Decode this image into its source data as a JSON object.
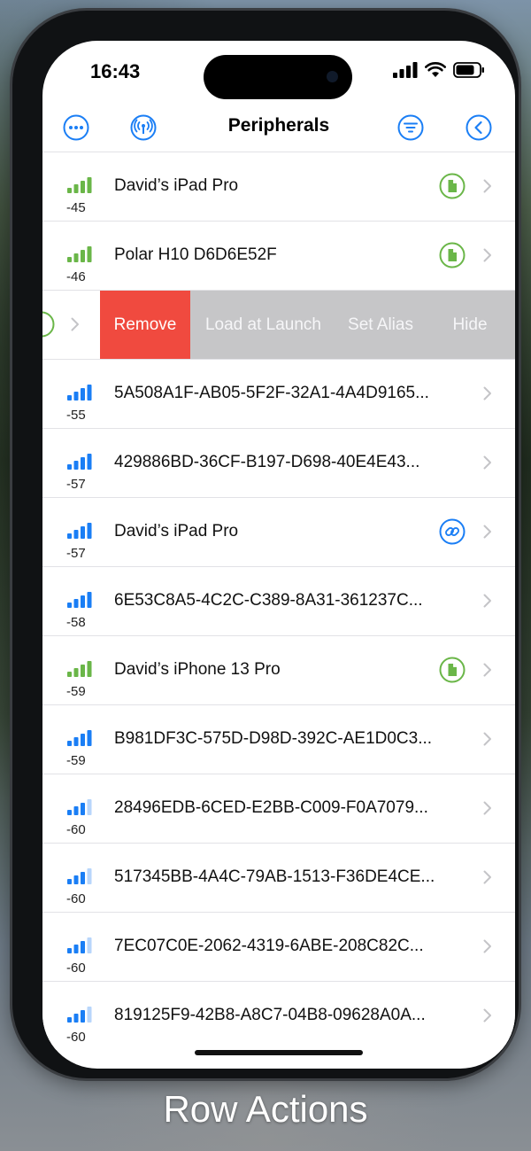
{
  "status_bar": {
    "time": "16:43"
  },
  "nav": {
    "title": "Peripherals"
  },
  "colors": {
    "accent": "#1a7ef5",
    "signal_green": "#6ab648",
    "remove_red": "#f04a3f",
    "action_gray": "#c6c6c8"
  },
  "rows_before": [
    {
      "rssi": "-45",
      "name": "David’s iPad Pro",
      "signal_color": "green",
      "bars": 4,
      "badge": "document-icon"
    },
    {
      "rssi": "-46",
      "name": "Polar H10 D6D6E52F",
      "signal_color": "green",
      "bars": 4,
      "badge": "document-icon"
    }
  ],
  "swipe_actions": [
    "Remove",
    "Load at Launch",
    "Set Alias",
    "Hide"
  ],
  "rows_after": [
    {
      "rssi": "-55",
      "name": "5A508A1F-AB05-5F2F-32A1-4A4D9165...",
      "signal_color": "blue",
      "bars": 4,
      "badge": ""
    },
    {
      "rssi": "-57",
      "name": "429886BD-36CF-B197-D698-40E4E43...",
      "signal_color": "blue",
      "bars": 4,
      "badge": ""
    },
    {
      "rssi": "-57",
      "name": "David’s iPad Pro",
      "signal_color": "blue",
      "bars": 4,
      "badge": "link-icon"
    },
    {
      "rssi": "-58",
      "name": "6E53C8A5-4C2C-C389-8A31-361237C...",
      "signal_color": "blue",
      "bars": 4,
      "badge": ""
    },
    {
      "rssi": "-59",
      "name": "David’s iPhone 13 Pro",
      "signal_color": "green",
      "bars": 4,
      "badge": "document-icon"
    },
    {
      "rssi": "-59",
      "name": "B981DF3C-575D-D98D-392C-AE1D0C3...",
      "signal_color": "blue",
      "bars": 4,
      "badge": ""
    },
    {
      "rssi": "-60",
      "name": "28496EDB-6CED-E2BB-C009-F0A7079...",
      "signal_color": "blue",
      "bars": 3,
      "badge": ""
    },
    {
      "rssi": "-60",
      "name": "517345BB-4A4C-79AB-1513-F36DE4CE...",
      "signal_color": "blue",
      "bars": 3,
      "badge": ""
    },
    {
      "rssi": "-60",
      "name": "7EC07C0E-2062-4319-6ABE-208C82C...",
      "signal_color": "blue",
      "bars": 3,
      "badge": ""
    },
    {
      "rssi": "-60",
      "name": "819125F9-42B8-A8C7-04B8-09628A0A...",
      "signal_color": "blue",
      "bars": 3,
      "badge": ""
    }
  ],
  "caption": "Row Actions"
}
